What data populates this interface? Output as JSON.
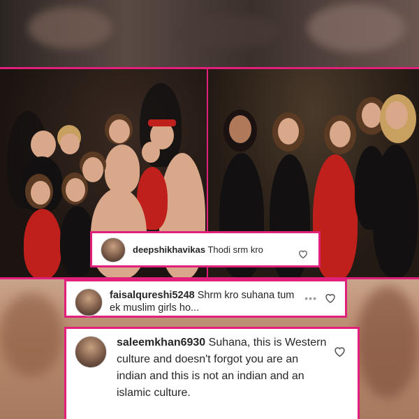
{
  "comments": [
    {
      "username": "deepshikhavikas",
      "text": "Thodi srm kro",
      "avatar_icon": "avatar-photo",
      "like_icon": "heart-outline-icon"
    },
    {
      "username": "faisalqureshi5248",
      "text": "Shrm kro suhana tum ek muslim girls ho...",
      "more_icon": "ellipsis-icon",
      "more_label": "•••",
      "avatar_icon": "avatar-photo",
      "like_icon": "heart-outline-icon"
    },
    {
      "username": "saleemkhan6930",
      "text": "Suhana, this is Western culture and doesn't forgot you are an indian and this is not an indian and an islamic culture.",
      "avatar_icon": "avatar-photo",
      "like_icon": "heart-outline-icon"
    }
  ],
  "colors": {
    "accent_border": "#e0207a",
    "comment_bg": "#ffffff",
    "text": "#262626"
  }
}
